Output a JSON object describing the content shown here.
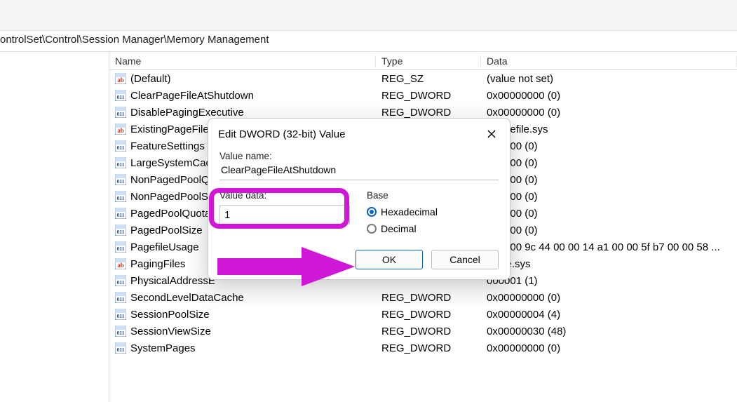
{
  "address": "ontrolSet\\Control\\Session Manager\\Memory Management",
  "columns": {
    "name": "Name",
    "type": "Type",
    "data": "Data"
  },
  "rows": [
    {
      "icon": "ab",
      "name": "(Default)",
      "type": "REG_SZ",
      "data": "(value not set)"
    },
    {
      "icon": "dw",
      "name": "ClearPageFileAtShutdown",
      "type": "REG_DWORD",
      "data": "0x00000000 (0)"
    },
    {
      "icon": "dw",
      "name": "DisablePagingExecutive",
      "type": "REG_DWORD",
      "data": "0x00000000 (0)"
    },
    {
      "icon": "ab",
      "name": "ExistingPageFiles",
      "type": "",
      "data": ":\\pagefile.sys"
    },
    {
      "icon": "dw",
      "name": "FeatureSettings",
      "type": "",
      "data": "000000 (0)"
    },
    {
      "icon": "dw",
      "name": "LargeSystemCach",
      "type": "",
      "data": "000000 (0)"
    },
    {
      "icon": "dw",
      "name": "NonPagedPoolQu",
      "type": "",
      "data": "000000 (0)"
    },
    {
      "icon": "dw",
      "name": "NonPagedPoolSiz",
      "type": "",
      "data": "000000 (0)"
    },
    {
      "icon": "dw",
      "name": "PagedPoolQuota",
      "type": "",
      "data": "000000 (0)"
    },
    {
      "icon": "dw",
      "name": "PagedPoolSize",
      "type": "",
      "data": "000000 (0)"
    },
    {
      "icon": "dw",
      "name": "PagefileUsage",
      "type": "",
      "data": "1 00 00 9c 44 00 00 14 a1 00 00 5f b7 00 00 58 ..."
    },
    {
      "icon": "ab",
      "name": "PagingFiles",
      "type": "",
      "data": "gefile.sys"
    },
    {
      "icon": "dw",
      "name": "PhysicalAddressE",
      "type": "",
      "data": "000001 (1)"
    },
    {
      "icon": "dw",
      "name": "SecondLevelDataCache",
      "type": "REG_DWORD",
      "data": "0x00000000 (0)"
    },
    {
      "icon": "dw",
      "name": "SessionPoolSize",
      "type": "REG_DWORD",
      "data": "0x00000004 (4)"
    },
    {
      "icon": "dw",
      "name": "SessionViewSize",
      "type": "REG_DWORD",
      "data": "0x00000030 (48)"
    },
    {
      "icon": "dw",
      "name": "SystemPages",
      "type": "REG_DWORD",
      "data": "0x00000000 (0)"
    }
  ],
  "dialog": {
    "title": "Edit DWORD (32-bit) Value",
    "valueNameLabel": "Value name:",
    "valueName": "ClearPageFileAtShutdown",
    "valueDataLabel": "Value data:",
    "valueData": "1",
    "baseLabel": "Base",
    "hex": "Hexadecimal",
    "dec": "Decimal",
    "ok": "OK",
    "cancel": "Cancel"
  }
}
